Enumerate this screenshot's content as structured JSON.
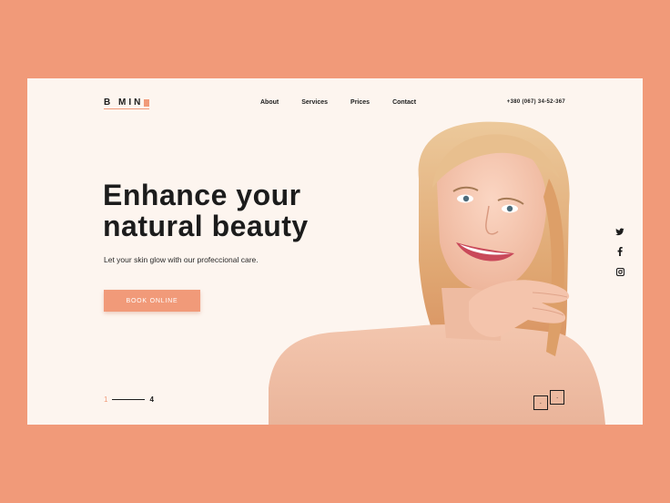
{
  "brand": {
    "logo_text": "B MIN"
  },
  "nav": {
    "items": [
      {
        "label": "About"
      },
      {
        "label": "Services"
      },
      {
        "label": "Prices"
      },
      {
        "label": "Contact"
      }
    ]
  },
  "header": {
    "phone": "+380 (067) 34-52-367"
  },
  "hero": {
    "headline_line1": "Enhance your",
    "headline_line2": "natural beauty",
    "subtext": "Let your skin glow with our profeccional care.",
    "cta_label": "BOOK ONLINE"
  },
  "slider": {
    "current": "1",
    "total": "4"
  },
  "social": {
    "icons": [
      "twitter-icon",
      "facebook-icon",
      "instagram-icon"
    ]
  },
  "colors": {
    "page_bg": "#f19a79",
    "card_bg": "#fdf5ef",
    "accent": "#f19a79",
    "text": "#1c1c1c"
  }
}
